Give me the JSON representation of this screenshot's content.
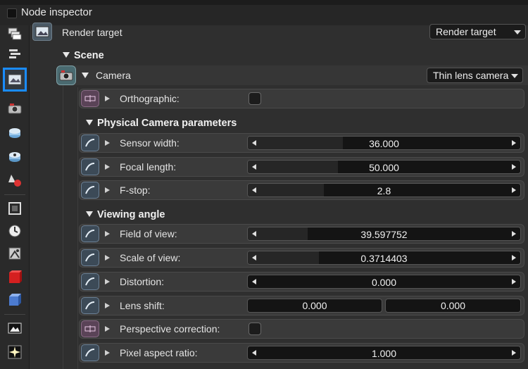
{
  "window": {
    "title": "Node inspector"
  },
  "toolbar": {
    "tools": [
      {
        "name": "node-inspector-tool-icon"
      },
      {
        "name": "graph-tool-icon"
      },
      {
        "name": "render-target-tool-icon",
        "active": true
      },
      {
        "name": "camera-tool-icon"
      },
      {
        "name": "environment-tool-icon"
      },
      {
        "name": "visible-environment-tool-icon"
      },
      {
        "name": "kernel-tool-icon"
      },
      {
        "name": "film-settings-tool-icon"
      },
      {
        "name": "animation-tool-icon"
      },
      {
        "name": "post-processing-tool-icon"
      },
      {
        "name": "geometry-tool-icon"
      },
      {
        "name": "mesh-tool-icon"
      },
      {
        "name": "image-tool-icon"
      },
      {
        "name": "light-tool-icon"
      }
    ],
    "accent": "#1a8cff"
  },
  "render_target": {
    "label": "Render target",
    "dropdown_value": "Render target"
  },
  "scene": {
    "heading": "Scene",
    "camera": {
      "label": "Camera",
      "type_value": "Thin lens camera",
      "orthographic_label": "Orthographic:",
      "orthographic_checked": false
    }
  },
  "physical": {
    "heading": "Physical Camera parameters",
    "params": [
      {
        "label": "Sensor width:",
        "value": "36.000",
        "fill": 0.35
      },
      {
        "label": "Focal length:",
        "value": "50.000",
        "fill": 0.33
      },
      {
        "label": "F-stop:",
        "value": "2.8",
        "fill": 0.28
      }
    ]
  },
  "viewing": {
    "heading": "Viewing angle",
    "fov": {
      "label": "Field of view:",
      "value": "39.597752",
      "fill": 0.22
    },
    "scale": {
      "label": "Scale of view:",
      "value": "0.3714403",
      "fill": 0.26
    },
    "distortion": {
      "label": "Distortion:",
      "value": "0.000",
      "fill": 0.0
    },
    "lens_shift": {
      "label": "Lens shift:",
      "x": "0.000",
      "y": "0.000"
    },
    "perspective": {
      "label": "Perspective correction:",
      "checked": false
    },
    "pixel_aspect": {
      "label": "Pixel aspect ratio:",
      "value": "1.000",
      "fill": 0.0
    }
  }
}
